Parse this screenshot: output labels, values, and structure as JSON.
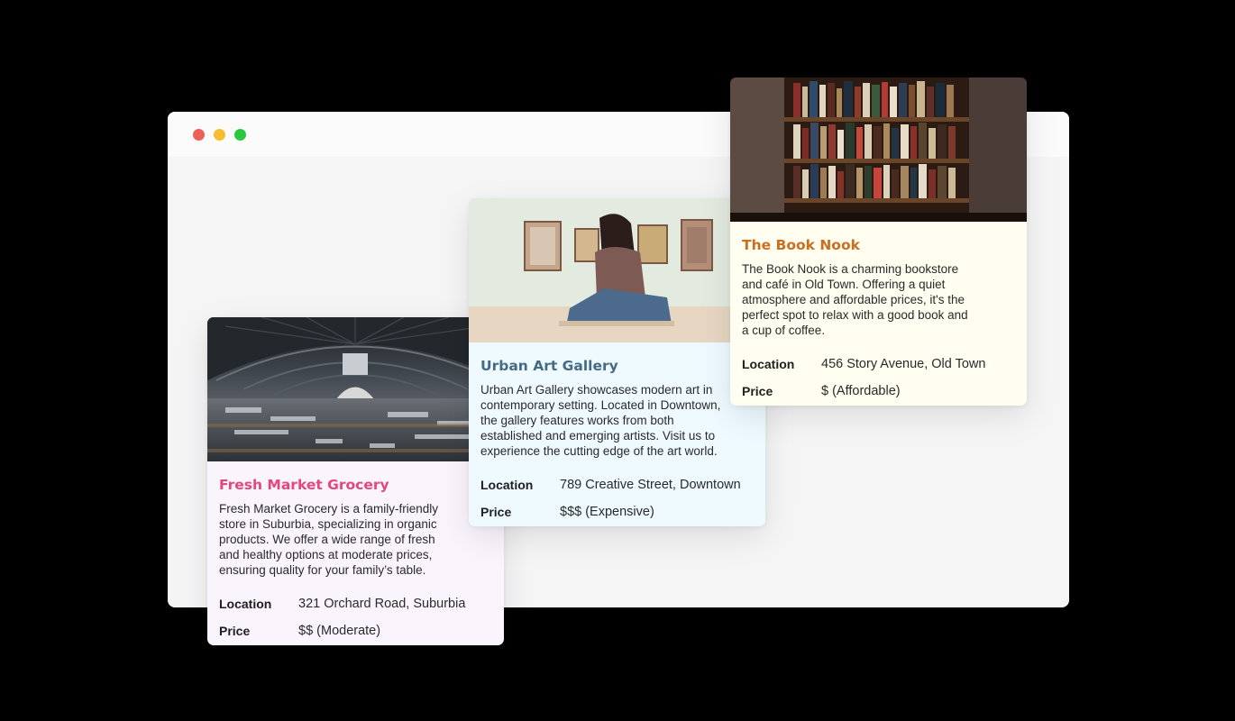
{
  "window": {
    "controls": [
      "close",
      "minimize",
      "maximize"
    ]
  },
  "cards": [
    {
      "id": "grocery",
      "title": "Fresh Market Grocery",
      "description": "Fresh Market Grocery is a family-friendly\nstore in Suburbia, specializing in organic\nproducts. We offer a wide range of fresh\nand healthy options at moderate prices,\nensuring quality for your family’s table.",
      "location_label": "Location",
      "location": "321 Orchard Road, Suburbia",
      "price_label": "Price",
      "price": "$$ (Moderate)",
      "title_color": "#e3477c",
      "background": "#faf5fc"
    },
    {
      "id": "gallery",
      "title": "Urban Art Gallery",
      "description": "Urban Art Gallery showcases modern art in\ncontemporary setting. Located in Downtown,\nthe gallery features works from both\nestablished and emerging artists. Visit us to\nexperience the cutting edge of the art world.",
      "location_label": "Location",
      "location": "789 Creative Street, Downtown",
      "price_label": "Price",
      "price": "$$$ (Expensive)",
      "title_color": "#466a85",
      "background": "#eefaff"
    },
    {
      "id": "book",
      "title": "The Book Nook",
      "description": "The Book Nook is a charming bookstore\nand café in Old Town. Offering a quiet\natmosphere and affordable prices, it's the\nperfect spot to relax with a good book and\na cup of coffee.",
      "location_label": "Location",
      "location": "456 Story Avenue, Old Town",
      "price_label": "Price",
      "price": "$ (Affordable)",
      "title_color": "#cd6e1f",
      "background": "#fffef0"
    }
  ]
}
